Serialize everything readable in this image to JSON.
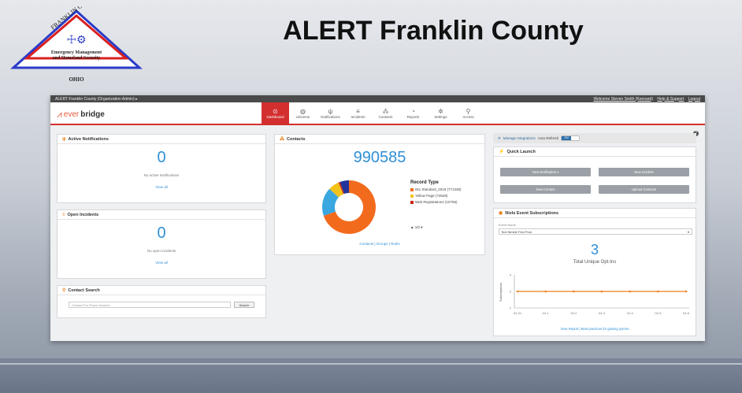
{
  "slide": {
    "title": "ALERT Franklin County",
    "logo": {
      "county_top": "FRANKLIN COUNTY",
      "line1": "Emergency Management",
      "line2": "and Homeland Security",
      "state": "OHIO"
    }
  },
  "topbar": {
    "account": "ALERT Franklin County (Organization Admin) ▸",
    "welcome": "Welcome Steven Smith (Kennard)",
    "help_support": "Help & Support",
    "logout": "Logout"
  },
  "brand": {
    "part1": "ever",
    "part2": "bridge"
  },
  "nav": [
    {
      "label": "Dashboard",
      "icon": "⊙",
      "icon_name": "dashboard-icon",
      "active": true
    },
    {
      "label": "Universe",
      "icon": "◍",
      "icon_name": "globe-icon"
    },
    {
      "label": "Notifications",
      "icon": "ψ",
      "icon_name": "broadcast-icon"
    },
    {
      "label": "Incidents",
      "icon": "≡",
      "icon_name": "list-icon"
    },
    {
      "label": "Contacts",
      "icon": "⁂",
      "icon_name": "people-icon"
    },
    {
      "label": "Reports",
      "icon": "◔",
      "icon_name": "pie-chart-icon"
    },
    {
      "label": "Settings",
      "icon": "✲",
      "icon_name": "gear-icon"
    },
    {
      "label": "Access",
      "icon": "⚲",
      "icon_name": "key-icon"
    }
  ],
  "active_notifications": {
    "title": "Active Notifications",
    "count": "0",
    "empty_text": "No active Notifications",
    "view_all": "View all"
  },
  "open_incidents": {
    "title": "Open Incidents",
    "count": "0",
    "empty_text": "No open Incidents",
    "view_all": "View all"
  },
  "contact_search": {
    "title": "Contact Search",
    "placeholder": "Contact For Phone Number",
    "button": "Search"
  },
  "contacts": {
    "title": "Contacts",
    "total": "990585",
    "record_type_label": "Record Type",
    "pager": "▲ 1/2 ▾",
    "links": "Contacts | Groups | Rules"
  },
  "chart_data": {
    "type": "pie",
    "title": "Record Type",
    "slices": [
      {
        "label": "911 Standard_2019 (771338)",
        "value": 771338,
        "color": "#f26b1d"
      },
      {
        "label": "",
        "value": 190000,
        "color": "#3aa7e0"
      },
      {
        "label": "Yellow Page (72628)",
        "value": 72628,
        "color": "#f2c21a"
      },
      {
        "label": "Web Registrations (10755)",
        "value": 10755,
        "color": "#c9251d"
      },
      {
        "label": "",
        "value": 60000,
        "color": "#22339a"
      }
    ]
  },
  "right": {
    "manage_integrations": "Manage Integrations",
    "auto_refresh": "Auto Refresh",
    "toggle_on": "ON",
    "quick_launch_title": "Quick Launch",
    "buttons": {
      "new_notification": "New Notification ▾",
      "new_incident": "New Incident",
      "new_contact": "New Contact",
      "upload_contacts": "Upload Contacts"
    },
    "nixle_title": "Nixle Event Subscriptions",
    "event_name_label": "Event Name",
    "event_selected": "Text Nimble First Post",
    "optins": "3",
    "optins_label": "Total Unique Opt-Ins",
    "ylabel": "Subscriptions",
    "x_ticks": [
      "04-31",
      "04-1",
      "04-2",
      "04-3",
      "04-4",
      "04-5",
      "04-6"
    ],
    "y_ticks": [
      "4",
      "3",
      "2"
    ],
    "links": "View Report | Best practices for gaining opt-ins"
  },
  "colors": {
    "accent_red": "#d32f2f",
    "link_blue": "#2f8fd6",
    "orange": "#e8821e"
  }
}
